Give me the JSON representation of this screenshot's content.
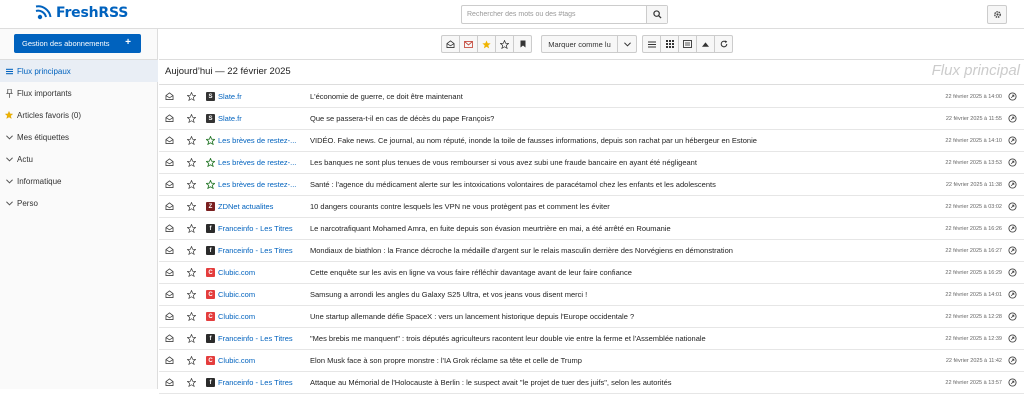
{
  "app": {
    "name": "FreshRSS"
  },
  "search": {
    "placeholder": "Rechercher des mots ou des #tags"
  },
  "sidebar": {
    "manage_label": "Gestion des abonnements",
    "items": [
      {
        "label": "Flux principaux",
        "icon": "list-icon",
        "active": true
      },
      {
        "label": "Flux importants",
        "icon": "pin-icon"
      },
      {
        "label": "Articles favoris (0)",
        "icon": "star-icon"
      },
      {
        "label": "Mes étiquettes",
        "icon": "chevron-icon"
      },
      {
        "label": "Actu",
        "icon": "chevron-icon"
      },
      {
        "label": "Informatique",
        "icon": "chevron-icon"
      },
      {
        "label": "Perso",
        "icon": "chevron-icon"
      }
    ]
  },
  "toolbar": {
    "mark_read_label": "Marquer comme lu"
  },
  "main": {
    "day_header": "Aujourd’hui — 22 février 2025",
    "watermark": "Flux principal",
    "accent": "#0062be",
    "articles": [
      {
        "feed": "Slate.fr",
        "feed_icon": "slate",
        "title": "L'économie de guerre, ce doit être maintenant",
        "date": "22 février 2025 à 14:00"
      },
      {
        "feed": "Slate.fr",
        "feed_icon": "slate",
        "title": "Que se passera-t-il en cas de décès du pape François?",
        "date": "22 février 2025 à 11:55"
      },
      {
        "feed": "Les brèves de restez-...",
        "feed_icon": "star",
        "title": "VIDÉO. Fake news. Ce journal, au nom réputé, inonde la toile de fausses informations, depuis son rachat par un hébergeur en Estonie",
        "date": "22 février 2025 à 14:10"
      },
      {
        "feed": "Les brèves de restez-...",
        "feed_icon": "star",
        "title": "Les banques ne sont plus tenues de vous rembourser si vous avez subi une fraude bancaire en ayant été négligeant",
        "date": "22 février 2025 à 13:53"
      },
      {
        "feed": "Les brèves de restez-...",
        "feed_icon": "star",
        "title": "Santé : l'agence du médicament alerte sur les intoxications volontaires de paracétamol chez les enfants et les adolescents",
        "date": "22 février 2025 à 11:38"
      },
      {
        "feed": "ZDNet actualites",
        "feed_icon": "zdnet",
        "title": "10 dangers courants contre lesquels les VPN ne vous protègent pas et comment les éviter",
        "date": "22 février 2025 à 03:02"
      },
      {
        "feed": "Franceinfo - Les Titres",
        "feed_icon": "franceinfo",
        "title": "Le narcotrafiquant Mohamed Amra, en fuite depuis son évasion meurtrière en mai, a été arrêté en Roumanie",
        "date": "22 février 2025 à 16:26"
      },
      {
        "feed": "Franceinfo - Les Titres",
        "feed_icon": "franceinfo",
        "title": "Mondiaux de biathlon : la France décroche la médaille d'argent sur le relais masculin derrière des Norvégiens en démonstration",
        "date": "22 février 2025 à 16:27"
      },
      {
        "feed": "Clubic.com",
        "feed_icon": "clubic",
        "title": "Cette enquête sur les avis en ligne va vous faire réfléchir davantage avant de leur faire confiance",
        "date": "22 février 2025 à 16:29"
      },
      {
        "feed": "Clubic.com",
        "feed_icon": "clubic",
        "title": "Samsung a arrondi les angles du Galaxy S25 Ultra, et vos jeans vous disent merci !",
        "date": "22 février 2025 à 14:01"
      },
      {
        "feed": "Clubic.com",
        "feed_icon": "clubic",
        "title": "Une startup allemande défie SpaceX : vers un lancement historique depuis l'Europe occidentale ?",
        "date": "22 février 2025 à 12:28"
      },
      {
        "feed": "Franceinfo - Les Titres",
        "feed_icon": "franceinfo",
        "title": "\"Mes brebis me manquent\" : trois députés agriculteurs racontent leur double vie entre la ferme et l'Assemblée nationale",
        "date": "22 février 2025 à 12:39"
      },
      {
        "feed": "Clubic.com",
        "feed_icon": "clubic",
        "title": "Elon Musk face à son propre monstre : l'IA Grok réclame sa tête et celle de Trump",
        "date": "22 février 2025 à 11:42"
      },
      {
        "feed": "Franceinfo - Les Titres",
        "feed_icon": "franceinfo",
        "title": "Attaque au Mémorial de l'Holocauste à Berlin : le suspect avait \"le projet de tuer des juifs\", selon les autorités",
        "date": "22 février 2025 à 13:57"
      }
    ]
  }
}
